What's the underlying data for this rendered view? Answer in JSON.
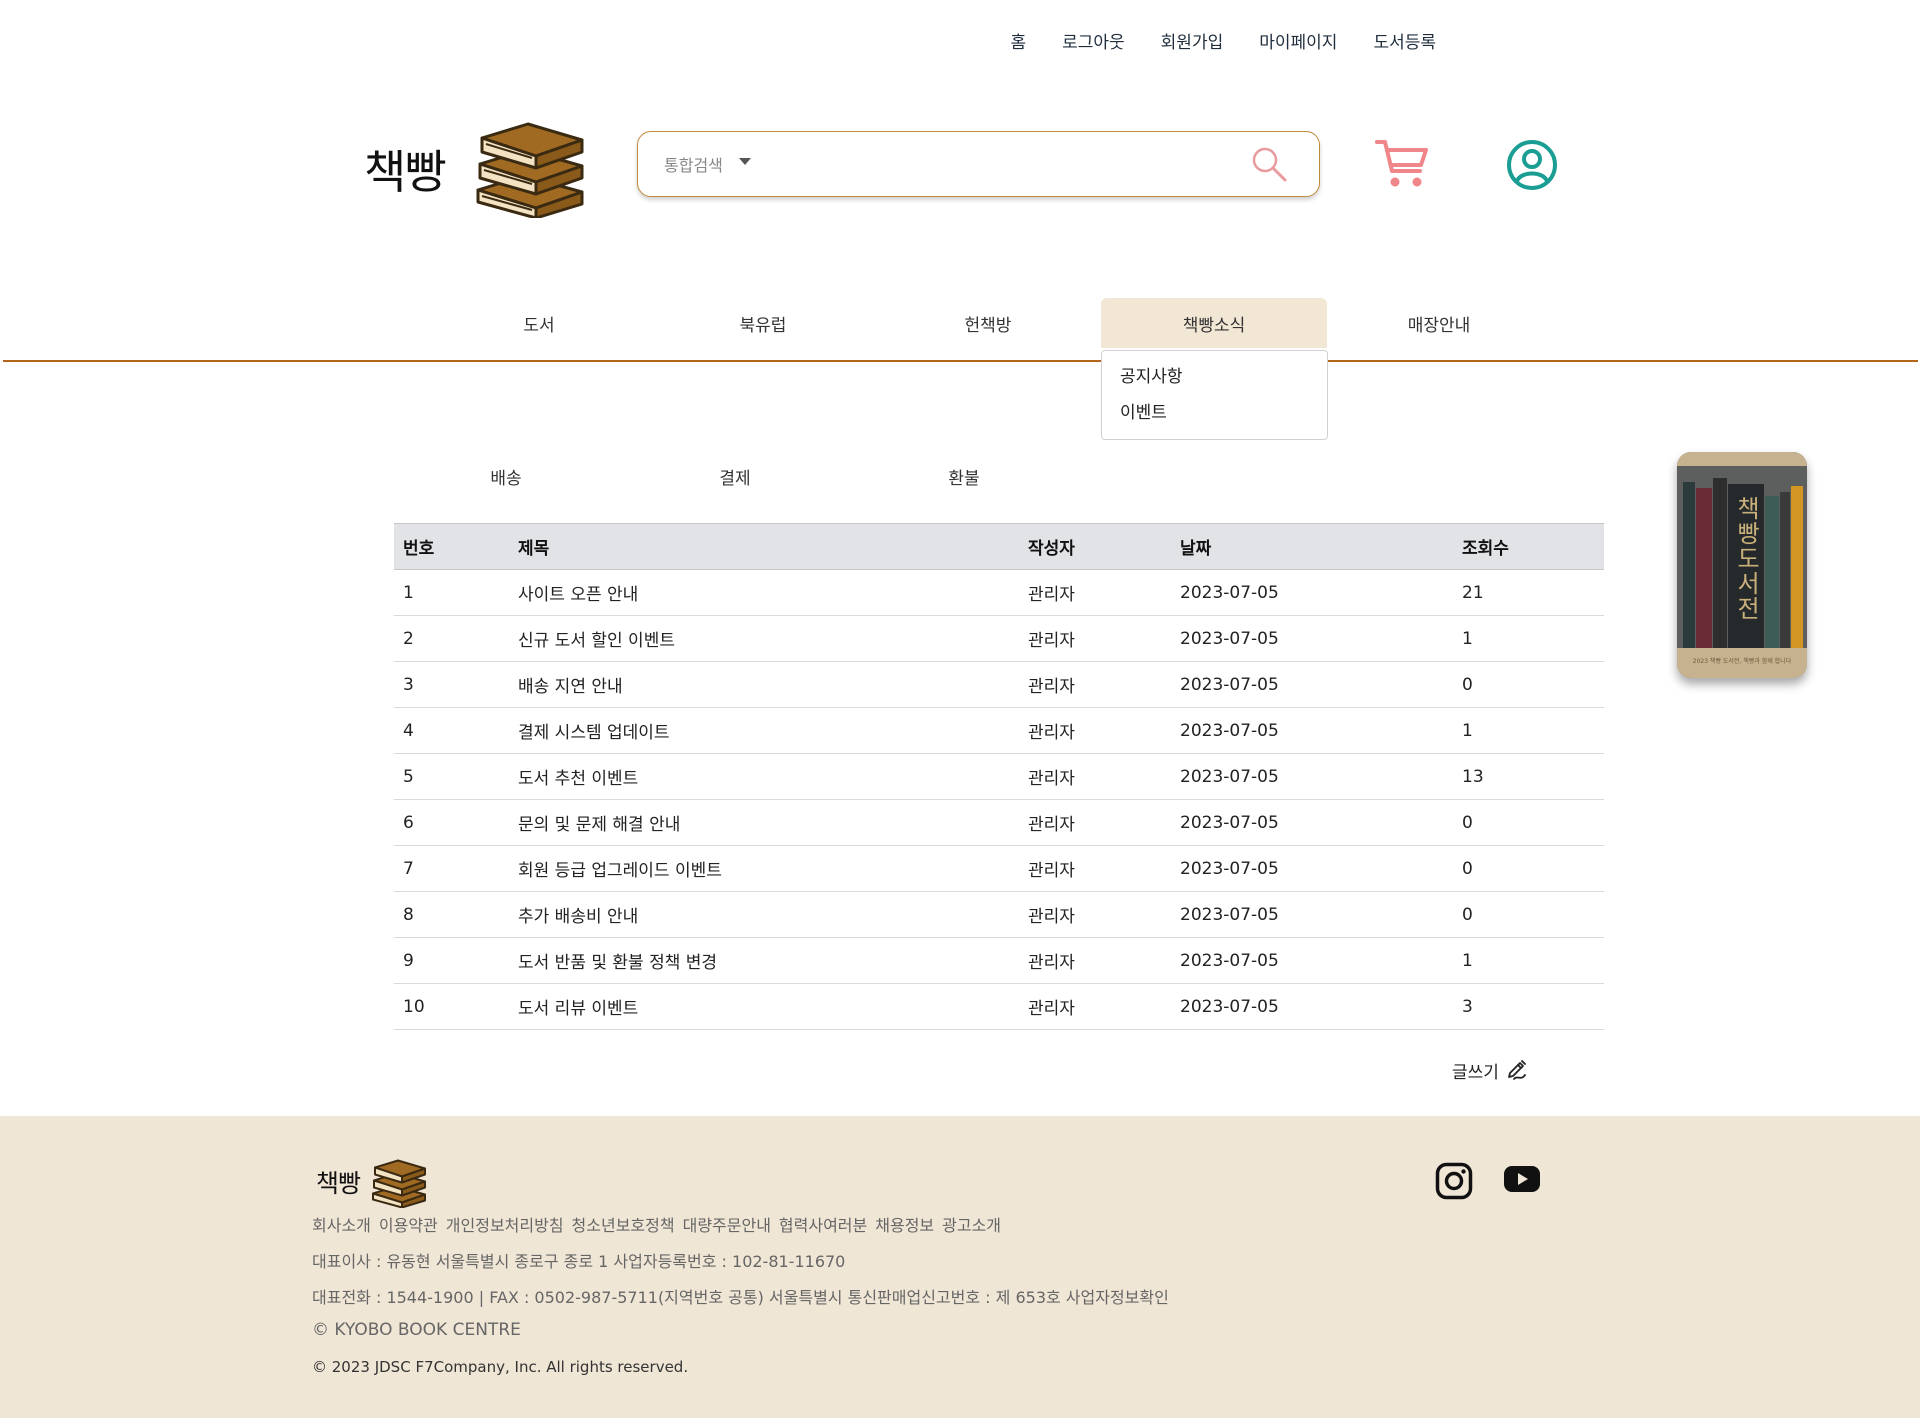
{
  "top_links": [
    "홈",
    "로그아웃",
    "회원가입",
    "마이페이지",
    "도서등록"
  ],
  "logo": {
    "text": "책빵"
  },
  "search": {
    "category": "통합검색",
    "placeholder": ""
  },
  "icons": {
    "search": "search-icon",
    "cart": "cart-icon",
    "user": "user-icon",
    "write": "pencil-icon",
    "instagram": "instagram-icon",
    "youtube": "youtube-icon"
  },
  "nav": {
    "items": [
      "도서",
      "북유럽",
      "헌책방",
      "책빵소식",
      "매장안내"
    ],
    "active": "책빵소식"
  },
  "dropdown": {
    "items": [
      "공지사항",
      "이벤트"
    ]
  },
  "subtabs": [
    "배송",
    "결제",
    "환불"
  ],
  "table": {
    "headers": [
      "번호",
      "제목",
      "작성자",
      "날짜",
      "조회수"
    ],
    "rows": [
      [
        "1",
        "사이트 오픈 안내",
        "관리자",
        "2023-07-05",
        "21"
      ],
      [
        "2",
        "신규 도서 할인 이벤트",
        "관리자",
        "2023-07-05",
        "1"
      ],
      [
        "3",
        "배송 지연 안내",
        "관리자",
        "2023-07-05",
        "0"
      ],
      [
        "4",
        "결제 시스템 업데이트",
        "관리자",
        "2023-07-05",
        "1"
      ],
      [
        "5",
        "도서 추천 이벤트",
        "관리자",
        "2023-07-05",
        "13"
      ],
      [
        "6",
        "문의 및 문제 해결 안내",
        "관리자",
        "2023-07-05",
        "0"
      ],
      [
        "7",
        "회원 등급 업그레이드 이벤트",
        "관리자",
        "2023-07-05",
        "0"
      ],
      [
        "8",
        "추가 배송비 안내",
        "관리자",
        "2023-07-05",
        "0"
      ],
      [
        "9",
        "도서 반품 및 환불 정책 변경",
        "관리자",
        "2023-07-05",
        "1"
      ],
      [
        "10",
        "도서 리뷰 이벤트",
        "관리자",
        "2023-07-05",
        "3"
      ]
    ]
  },
  "write_label": "글쓰기",
  "banner": {
    "title": "책빵도서전",
    "caption": "2023 책빵 도서전, 책빵과 함께 합니다"
  },
  "footer": {
    "logo_text": "책빵",
    "links": [
      "회사소개",
      "이용약관",
      "개인정보처리방침",
      "청소년보호정책",
      "대량주문안내",
      "협력사여러분",
      "채용정보",
      "광고소개"
    ],
    "line1": "대표이사 : 유동현 서울특별시 종로구 종로 1 사업자등록번호 : 102-81-11670",
    "line2": "대표전화 : 1544-1900 | FAX : 0502-987-5711(지역번호 공통) 서울특별시 통신판매업신고번호 : 제 653호 사업자정보확인",
    "line3": "© KYOBO BOOK CENTRE",
    "line4": "© 2023 JDSC F7Company, Inc. All rights reserved."
  },
  "colors": {
    "brand_brown": "#b4651c",
    "nav_active_bg": "#f2e6d4",
    "footer_bg": "#f0e6d6",
    "cart_pink": "#f0858a",
    "user_teal": "#1a9e93"
  }
}
